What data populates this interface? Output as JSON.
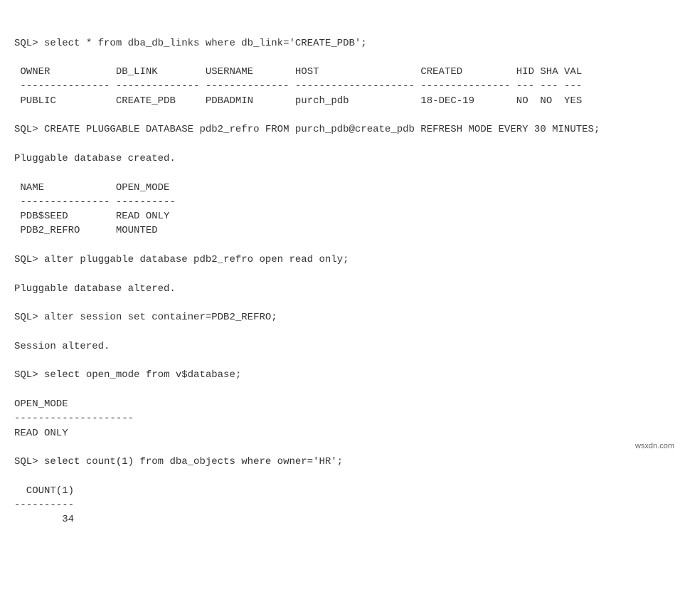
{
  "q1": {
    "prompt": "SQL> ",
    "text": "select * from dba_db_links where db_link='CREATE_PDB';"
  },
  "dblinks": {
    "hdr": {
      "owner": "OWNER",
      "db_link": "DB_LINK",
      "username": "USERNAME",
      "host": "HOST",
      "created": "CREATED",
      "hid": "HID",
      "sha": "SHA",
      "val": "VAL"
    },
    "rule": {
      "owner": "---------------",
      "db_link": "--------------",
      "username": "--------------",
      "host": "--------------------",
      "created": "---------------",
      "hid": "---",
      "sha": "---",
      "val": "---"
    },
    "row": {
      "owner": "PUBLIC",
      "db_link": "CREATE_PDB",
      "username": "PDBADMIN",
      "host": "purch_pdb",
      "created": "18-DEC-19",
      "hid": "NO",
      "sha": "NO",
      "val": "YES"
    }
  },
  "q2": {
    "prompt": "SQL> ",
    "text": "CREATE PLUGGABLE DATABASE pdb2_refro FROM purch_pdb@create_pdb REFRESH MODE EVERY 30 MINUTES;"
  },
  "msg1": "Pluggable database created.",
  "pdbs": {
    "hdr": {
      "name": "NAME",
      "mode": "OPEN_MODE"
    },
    "rule": {
      "name": "---------------",
      "mode": "----------"
    },
    "r1": {
      "name": "PDB$SEED",
      "mode": "READ ONLY"
    },
    "r2": {
      "name": "PDB2_REFRO",
      "mode": "MOUNTED"
    }
  },
  "q3": {
    "prompt": "SQL> ",
    "text": "alter pluggable database pdb2_refro open read only;"
  },
  "msg2": "Pluggable database altered.",
  "q4": {
    "prompt": "SQL> ",
    "text": "alter session set container=PDB2_REFRO;"
  },
  "msg3": "Session altered.",
  "q5": {
    "prompt": "SQL> ",
    "text": "select open_mode from v$database;"
  },
  "openmode": {
    "hdr": "OPEN_MODE",
    "rule": "--------------------",
    "val": "READ ONLY"
  },
  "q6": {
    "prompt": "SQL> ",
    "text": "select count(1) from dba_objects where owner='HR';"
  },
  "count": {
    "hdr": "  COUNT(1)",
    "rule": "----------",
    "val": "        34"
  },
  "watermark": "wsxdn.com"
}
